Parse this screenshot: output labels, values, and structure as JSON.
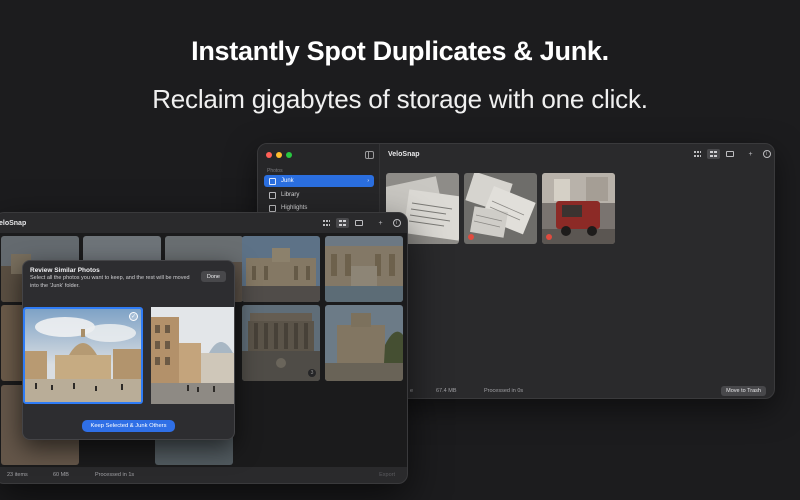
{
  "headline": "Instantly Spot Duplicates & Junk.",
  "subline": "Reclaim gigabytes of storage with one click.",
  "back_window": {
    "title": "VeloSnap",
    "sidebar": {
      "section": "Photos",
      "items": [
        {
          "label": "Junk",
          "icon": "trash-icon",
          "active": true,
          "chevron": "›"
        },
        {
          "label": "Library",
          "icon": "photo-library-icon"
        },
        {
          "label": "Highlights",
          "icon": "star-icon"
        }
      ]
    },
    "toolbar": {
      "add": "+",
      "info": "i"
    },
    "status": {
      "items_suffix": "e",
      "size": "67.4 MB",
      "processed": "Processed in 0s"
    },
    "move_to_trash": "Move to Trash"
  },
  "front_window": {
    "title": "eloSnap",
    "toolbar": {
      "add": "+",
      "info": "i"
    },
    "status": {
      "items": "23 items",
      "size": "60 MB",
      "processed": "Processed in 1s",
      "export": "Export"
    },
    "modal": {
      "title": "Review Similar Photos",
      "description": "Select all the photos you want to keep, and the rest will be moved into the 'Junk' folder.",
      "done": "Done",
      "keep_button": "Keep Selected & Junk Others",
      "check": "✓"
    },
    "badge_value": "3"
  },
  "colors": {
    "accent": "#2f6fe6",
    "background": "#1c1c1e",
    "junk_badge": "#e04b3f"
  }
}
